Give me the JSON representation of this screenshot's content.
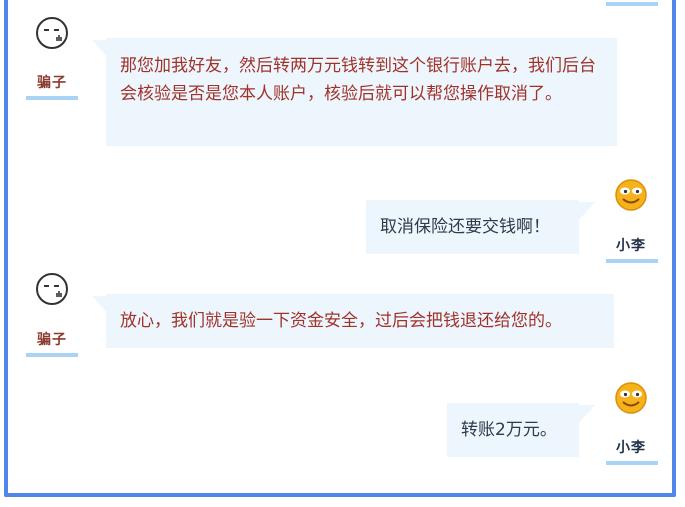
{
  "messages": [
    {
      "sender": "骗子",
      "side": "left",
      "text": "那您加我好友，然后转两万元钱转到这个银行账户去，我们后台会核验是否是您本人账户，核验后就可以帮您操作取消了。"
    },
    {
      "sender": "小李",
      "side": "right",
      "text": "取消保险还要交钱啊！"
    },
    {
      "sender": "骗子",
      "side": "left",
      "text": "放心，我们就是验一下资金安全，过后会把钱退还给您的。"
    },
    {
      "sender": "小李",
      "side": "right",
      "text": "转账2万元。"
    }
  ],
  "colors": {
    "frame_border": "#4f86e8",
    "bubble_bg": "#edf6fd",
    "name_underline": "#a9d3f5",
    "scammer_text": "#a0322a",
    "xiaoli_text": "#2f3a4a"
  },
  "icons": {
    "scammer_avatar": "smirk-face-outline-icon",
    "xiaoli_avatar": "smiling-face-yellow-icon"
  }
}
